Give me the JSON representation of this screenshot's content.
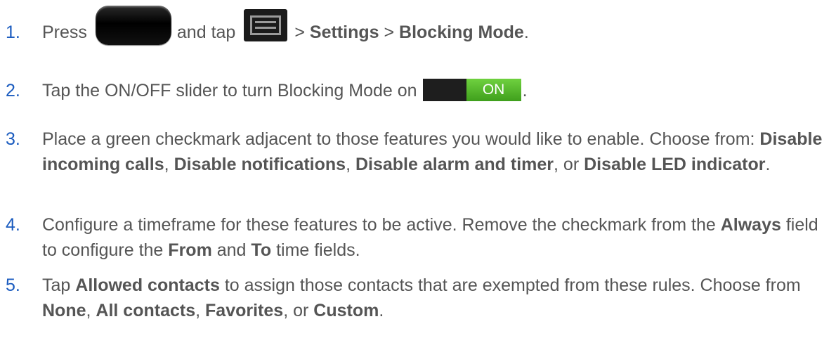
{
  "steps": [
    {
      "number": "1.",
      "parts": {
        "press": "Press",
        "and_tap": "and tap",
        "sep1": ">",
        "settings": "Settings",
        "sep2": ">",
        "blocking_mode": "Blocking Mode",
        "end": "."
      },
      "icons": [
        "home-button-icon",
        "menu-button-icon"
      ]
    },
    {
      "number": "2.",
      "parts": {
        "text": "Tap the ON/OFF slider to turn Blocking Mode on",
        "toggle_label": "ON",
        "end": "."
      }
    },
    {
      "number": "3.",
      "parts": {
        "text1": "Place a green checkmark adjacent to those features you would like to enable. Choose from:",
        "opt1": "Disable incoming calls",
        "comma1": ",",
        "opt2": "Disable notifications",
        "comma2": ",",
        "opt3": "Disable alarm and timer",
        "or": ", or",
        "opt4": "Disable LED indicator",
        "end": "."
      }
    },
    {
      "number": "4.",
      "parts": {
        "text1": "Configure a timeframe for these features to be active. Remove the checkmark from the",
        "always": "Always",
        "text2": "field to configure the",
        "from": "From",
        "and": "and",
        "to": "To",
        "text3": "time fields."
      }
    },
    {
      "number": "5.",
      "parts": {
        "tap": "Tap",
        "allowed": "Allowed contacts",
        "text1": "to assign those contacts that are exempted from these rules. Choose from",
        "none": "None",
        "comma1": ",",
        "all": "All contacts",
        "comma2": ",",
        "fav": "Favorites",
        "or": ", or",
        "custom": "Custom",
        "end": "."
      }
    }
  ],
  "colors": {
    "number": "#1a5bbf",
    "text": "#555555",
    "toggle_on": "#4fb52a"
  }
}
